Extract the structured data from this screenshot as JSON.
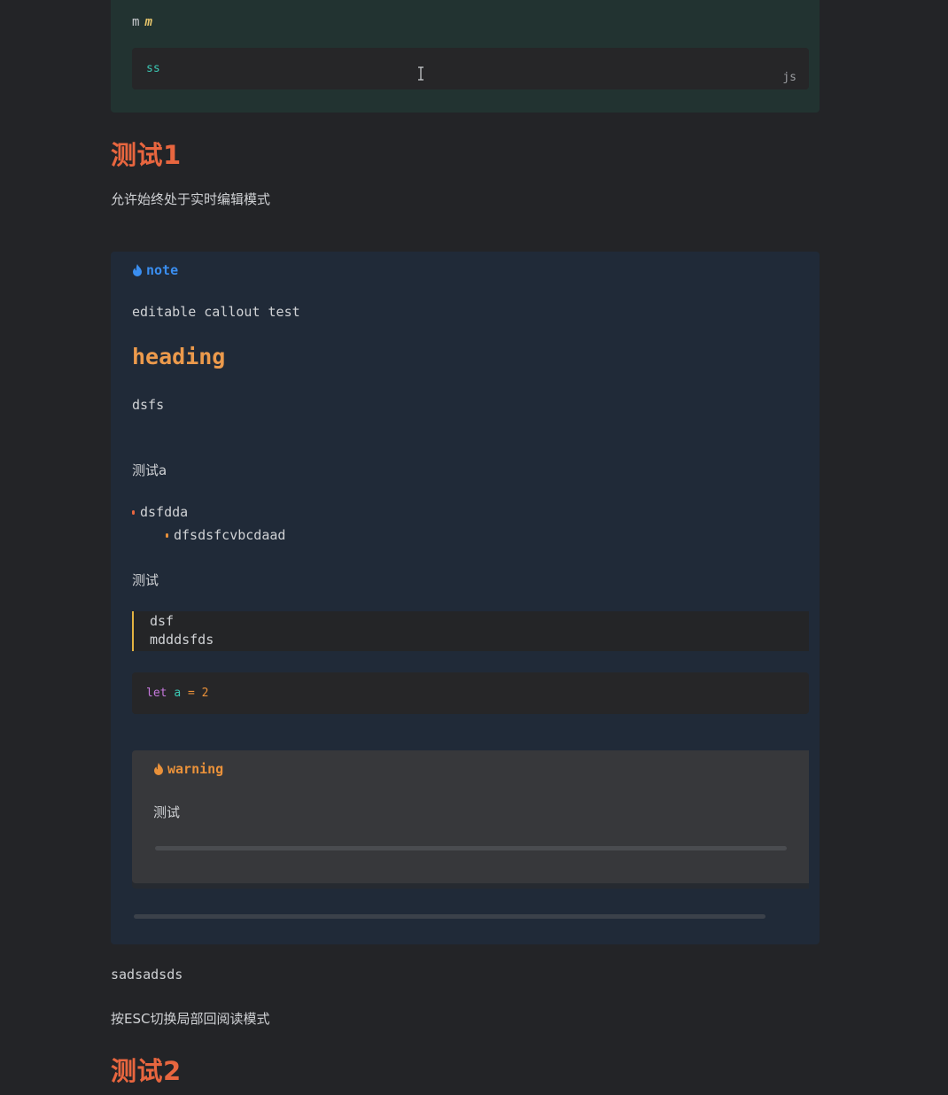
{
  "top_callout": {
    "line_plain": "m",
    "line_emphasis": "m",
    "code": "ss",
    "code_lang": "js"
  },
  "section1": {
    "heading": "测试1",
    "paragraph": "允许始终处于实时编辑模式"
  },
  "note_callout": {
    "title": "note",
    "line1": "editable callout test",
    "heading": "heading",
    "line2": "dsfs",
    "line3": "测试a",
    "bullets": [
      {
        "text": "dsfdda",
        "level": 1
      },
      {
        "text": "dfsdsfcvbcdaad",
        "level": 2
      }
    ],
    "line4": "测试",
    "quote_lines": [
      "dsf",
      "mdddsfds"
    ],
    "code": {
      "keyword": "let",
      "variable": "a",
      "operator": "=",
      "value": "2"
    },
    "warning_callout": {
      "title": "warning",
      "body": "测试"
    }
  },
  "after": {
    "line1": "sadsadsds",
    "line2": "按ESC切换局部回阅读模式",
    "heading2": "测试2"
  },
  "colors": {
    "background": "#232427",
    "heading": "#e8663f",
    "note_accent": "#3a8ef0",
    "warning_accent": "#e9913a",
    "quote_border": "#e3b341",
    "green_callout_bg": "#223331",
    "note_callout_bg": "#202a38"
  }
}
